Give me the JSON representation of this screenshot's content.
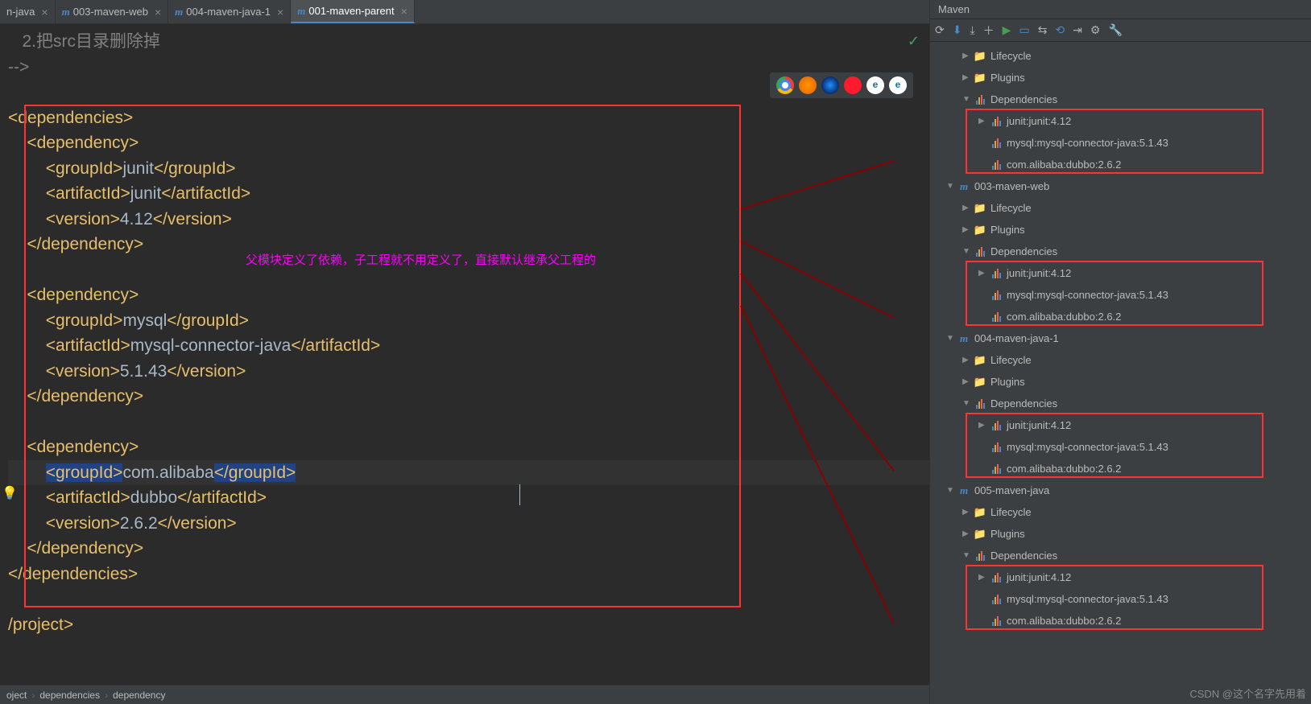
{
  "tabs": [
    {
      "label": "n-java",
      "partial": true
    },
    {
      "label": "003-maven-web"
    },
    {
      "label": "004-maven-java-1"
    },
    {
      "label": "001-maven-parent",
      "active": true
    }
  ],
  "editor": {
    "comment_line": "   2.把src目录删除掉",
    "comment_end": "-->",
    "annotation": "父模块定义了依赖，子工程就不用定义了，直接默认继承父工程的",
    "dependencies": [
      {
        "groupId": "junit",
        "artifactId": "junit",
        "version": "4.12"
      },
      {
        "groupId": "mysql",
        "artifactId": "mysql-connector-java",
        "version": "5.1.43"
      },
      {
        "groupId": "com.alibaba",
        "artifactId": "dubbo",
        "version": "2.6.2"
      }
    ],
    "tags": {
      "deps_open": "<dependencies>",
      "deps_close": "</dependencies>",
      "dep_open": "<dependency>",
      "dep_close": "</dependency>",
      "gid_open": "<groupId>",
      "gid_close": "</groupId>",
      "aid_open": "<artifactId>",
      "aid_close": "</artifactId>",
      "ver_open": "<version>",
      "ver_close": "</version>",
      "proj_close": "/project>"
    }
  },
  "breadcrumbs": [
    "oject",
    "dependencies",
    "dependency"
  ],
  "maven": {
    "title": "Maven",
    "modules": [
      {
        "name": "",
        "lifecycle": "Lifecycle",
        "plugins": "Plugins",
        "deps_label": "Dependencies",
        "deps": [
          "junit:junit:4.12",
          "mysql:mysql-connector-java:5.1.43",
          "com.alibaba:dubbo:2.6.2"
        ]
      },
      {
        "name": "003-maven-web",
        "lifecycle": "Lifecycle",
        "plugins": "Plugins",
        "deps_label": "Dependencies",
        "deps": [
          "junit:junit:4.12",
          "mysql:mysql-connector-java:5.1.43",
          "com.alibaba:dubbo:2.6.2"
        ]
      },
      {
        "name": "004-maven-java-1",
        "lifecycle": "Lifecycle",
        "plugins": "Plugins",
        "deps_label": "Dependencies",
        "deps": [
          "junit:junit:4.12",
          "mysql:mysql-connector-java:5.1.43",
          "com.alibaba:dubbo:2.6.2"
        ]
      },
      {
        "name": "005-maven-java",
        "lifecycle": "Lifecycle",
        "plugins": "Plugins",
        "deps_label": "Dependencies",
        "deps": [
          "junit:junit:4.12",
          "mysql:mysql-connector-java:5.1.43",
          "com.alibaba:dubbo:2.6.2"
        ]
      }
    ]
  },
  "watermark": "CSDN @这个名字先用着"
}
